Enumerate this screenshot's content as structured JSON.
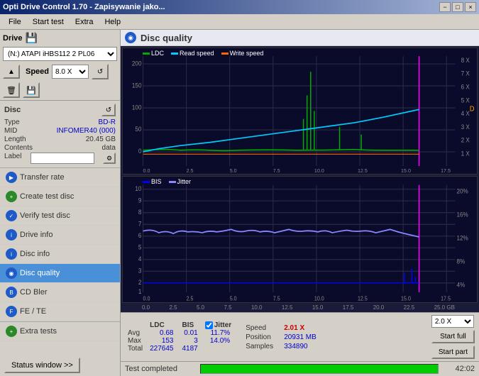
{
  "window": {
    "title": "Opti Drive Control 1.70 - Zapisywanie jako...",
    "controls": [
      "−",
      "□",
      "×"
    ]
  },
  "menu": {
    "items": [
      "File",
      "Start test",
      "Extra",
      "Help"
    ]
  },
  "drive": {
    "label": "Drive",
    "value": "(N:)  ATAPI iHBS112  2 PL06",
    "speed_label": "Speed",
    "speed_value": "8.0 X"
  },
  "disc": {
    "title": "Disc",
    "type_label": "Type",
    "type_value": "BD-R",
    "mid_label": "MID",
    "mid_value": "INFOMER40 (000)",
    "length_label": "Length",
    "length_value": "20.45 GB",
    "contents_label": "Contents",
    "contents_value": "data",
    "label_label": "Label",
    "label_value": ""
  },
  "nav": {
    "items": [
      {
        "id": "transfer-rate",
        "label": "Transfer rate",
        "active": false
      },
      {
        "id": "create-test-disc",
        "label": "Create test disc",
        "active": false
      },
      {
        "id": "verify-test-disc",
        "label": "Verify test disc",
        "active": false
      },
      {
        "id": "drive-info",
        "label": "Drive info",
        "active": false
      },
      {
        "id": "disc-info",
        "label": "Disc info",
        "active": false
      },
      {
        "id": "disc-quality",
        "label": "Disc quality",
        "active": true
      },
      {
        "id": "cd-bler",
        "label": "CD Bler",
        "active": false
      },
      {
        "id": "fe-te",
        "label": "FE / TE",
        "active": false
      },
      {
        "id": "extra-tests",
        "label": "Extra tests",
        "active": false
      }
    ],
    "status_window": "Status window >>",
    "status_completed": "Test completed"
  },
  "disc_quality": {
    "title": "Disc quality",
    "legend": {
      "ldc": "LDC",
      "read_speed": "Read speed",
      "write_speed": "Write speed",
      "bis": "BIS",
      "jitter": "Jitter"
    },
    "top_chart": {
      "y_labels": [
        "200",
        "150",
        "100",
        "50",
        "0"
      ],
      "y_right": [
        "8 X",
        "7 X",
        "6 X",
        "5 X",
        "4 X",
        "3 X",
        "2 X",
        "1 X"
      ],
      "x_labels": [
        "0.0",
        "2.5",
        "5.0",
        "7.5",
        "10.0",
        "12.5",
        "15.0",
        "17.5",
        "20.0",
        "22.5",
        "25.0 GB"
      ]
    },
    "bottom_chart": {
      "y_labels": [
        "10",
        "9",
        "8",
        "7",
        "6",
        "5",
        "4",
        "3",
        "2",
        "1"
      ],
      "y_right": [
        "20%",
        "16%",
        "12%",
        "8%",
        "4%"
      ],
      "x_labels": [
        "0.0",
        "2.5",
        "5.0",
        "7.5",
        "10.0",
        "12.5",
        "15.0",
        "17.5",
        "20.0",
        "22.5",
        "25.0 GB"
      ]
    }
  },
  "stats": {
    "headers": [
      "LDC",
      "BIS",
      "",
      "Jitter",
      "Speed",
      ""
    ],
    "avg_label": "Avg",
    "avg_ldc": "0.68",
    "avg_bis": "0.01",
    "avg_jitter": "11.7%",
    "avg_speed": "2.01 X",
    "max_label": "Max",
    "max_ldc": "153",
    "max_bis": "3",
    "max_jitter": "14.0%",
    "total_label": "Total",
    "total_ldc": "227645",
    "total_bis": "4187",
    "position_label": "Position",
    "position_value": "20931 MB",
    "samples_label": "Samples",
    "samples_value": "334890",
    "jitter_checkbox": true,
    "jitter_label": "Jitter",
    "speed_select": "2.0 X",
    "start_full": "Start full",
    "start_part": "Start part"
  },
  "progress": {
    "label": "Test completed",
    "percent": 100,
    "time": "42:02"
  }
}
